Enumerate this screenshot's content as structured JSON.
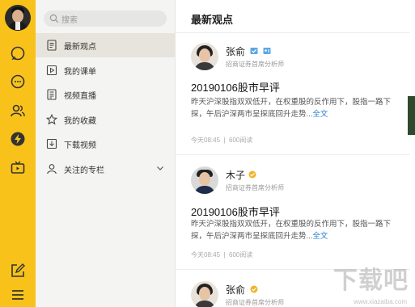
{
  "sidebar": {
    "search_placeholder": "搜索",
    "items": [
      {
        "label": "最新观点",
        "icon": "document-icon",
        "active": true
      },
      {
        "label": "我的课单",
        "icon": "play-list-icon",
        "active": false
      },
      {
        "label": "视频直播",
        "icon": "live-doc-icon",
        "active": false
      },
      {
        "label": "我的收藏",
        "icon": "star-icon",
        "active": false
      },
      {
        "label": "下载视频",
        "icon": "download-icon",
        "active": false
      },
      {
        "label": "关注的专栏",
        "icon": "user-icon",
        "active": false
      }
    ]
  },
  "rail": {
    "icons": [
      "chat-bubble-icon",
      "message-icon",
      "contacts-icon",
      "flash-icon",
      "tv-icon",
      "edit-icon",
      "menu-icon"
    ],
    "accent": "#f8c21a"
  },
  "main": {
    "title": "最新观点",
    "posts": [
      {
        "author": "张俞",
        "author_title": "招商证券首席分析师",
        "title": "20190106股市早评",
        "body": "昨天沪深股指双双低开，在权重股的反作用下，股指一路下探，午后沪深两市呈探底回升走势...",
        "more": "全文",
        "time": "今天08:45",
        "reads": "600阅读"
      },
      {
        "author": "木子",
        "author_title": "招商证券首席分析师",
        "title": "20190106股市早评",
        "body": "昨天沪深股指双双低开，在权重股的反作用下，股指一路下探，午后沪深两市呈探底回升走势...",
        "more": "全文",
        "time": "今天08:45",
        "reads": "600阅读"
      },
      {
        "author": "张俞",
        "author_title": "招商证券首席分析师"
      }
    ],
    "link_color": "#2a7fd4"
  },
  "watermark": {
    "text": "下载吧",
    "url": "www.xiazaiba.com"
  }
}
